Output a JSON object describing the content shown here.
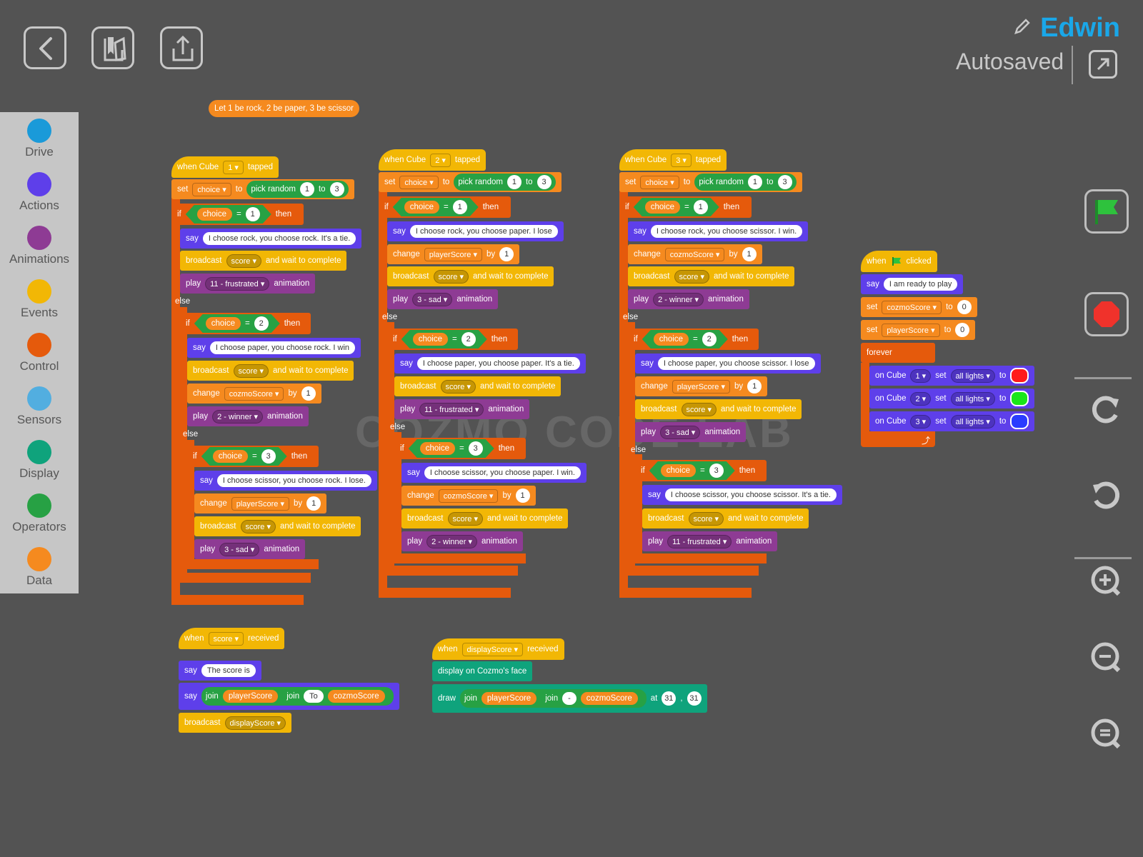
{
  "header": {
    "project_name": "Edwin",
    "save_status": "Autosaved",
    "back_icon": "chevron-left-icon",
    "book_icon": "book-icon",
    "share_icon": "share-icon"
  },
  "palette": {
    "categories": [
      {
        "label": "Drive",
        "color": "#1a9ad9"
      },
      {
        "label": "Actions",
        "color": "#5e3fea"
      },
      {
        "label": "Animations",
        "color": "#8e3b94"
      },
      {
        "label": "Events",
        "color": "#f2b705"
      },
      {
        "label": "Control",
        "color": "#e55a0c"
      },
      {
        "label": "Sensors",
        "color": "#52aee0"
      },
      {
        "label": "Display",
        "color": "#0fa37c"
      },
      {
        "label": "Operators",
        "color": "#27a144"
      },
      {
        "label": "Data",
        "color": "#f58a1f"
      }
    ]
  },
  "watermark": "COZMO CODE LAB",
  "comment": "Let 1 be rock, 2 be paper, 3 be scissor",
  "words": {
    "when": "when",
    "when_cube": "when Cube",
    "tapped": "tapped",
    "clicked": "clicked",
    "received": "received",
    "set": "set",
    "to": "to",
    "pick_random": "pick random",
    "if": "if",
    "then": "then",
    "else": "else",
    "equals": "=",
    "say": "say",
    "broadcast": "broadcast",
    "wait": "and wait to complete",
    "play": "play",
    "animation": "animation",
    "change": "change",
    "by": "by",
    "forever": "forever",
    "on_cube": "on Cube",
    "all_lights": "all lights",
    "join": "join",
    "display_face": "display on Cozmo's face",
    "draw": "draw",
    "at": "at",
    "comma": ","
  },
  "vars": {
    "choice": "choice",
    "score": "score",
    "player": "playerScore",
    "cozmo": "cozmoScore",
    "display": "displayScore"
  },
  "anims": {
    "frustrated": "11 - frustrated",
    "winner": "2 - winner",
    "sad": "3 - sad"
  },
  "scripts": {
    "cube1": {
      "cube": "1",
      "random_from": "1",
      "random_to": "3",
      "v1": "1",
      "say1": "I choose rock, you choose rock. It's a tie.",
      "v2": "2",
      "say2": "I choose paper, you choose rock. I win",
      "by2": "1",
      "v3": "3",
      "say3": "I choose scissor, you choose rock. I lose.",
      "by3": "1"
    },
    "cube2": {
      "cube": "2",
      "random_from": "1",
      "random_to": "3",
      "v1": "1",
      "say1": "I choose rock, you choose paper. I lose",
      "by1": "1",
      "v2": "2",
      "say2": "I choose paper, you choose paper. It's a tie.",
      "v3": "3",
      "say3": "I choose scissor, you choose paper. I win.",
      "by3": "1"
    },
    "cube3": {
      "cube": "3",
      "random_from": "1",
      "random_to": "3",
      "v1": "1",
      "say1": "I choose rock, you choose scissor. I win.",
      "by1": "1",
      "v2": "2",
      "say2": "I choose paper, you choose scissor. I lose",
      "by2": "1",
      "v3": "3",
      "say3": "I choose scissor, you choose scissor. It's a tie."
    },
    "flag": {
      "say": "I am ready to play",
      "cozmo_init": "0",
      "player_init": "0",
      "cubes": [
        {
          "cube": "1",
          "color": "#ff1a1a"
        },
        {
          "cube": "2",
          "color": "#19e619"
        },
        {
          "cube": "3",
          "color": "#2a3cff"
        }
      ]
    },
    "score": {
      "say": "The score is",
      "join_text": "To"
    },
    "display": {
      "join_text": "-",
      "x": "31",
      "y": "31"
    }
  },
  "right_toolbar": {
    "start_icon": "green-flag-icon",
    "stop_icon": "stop-icon",
    "redo_icon": "redo-icon",
    "undo_icon": "undo-icon",
    "zoom_in_icon": "zoom-in-icon",
    "zoom_out_icon": "zoom-out-icon",
    "zoom_reset_icon": "zoom-reset-icon"
  }
}
